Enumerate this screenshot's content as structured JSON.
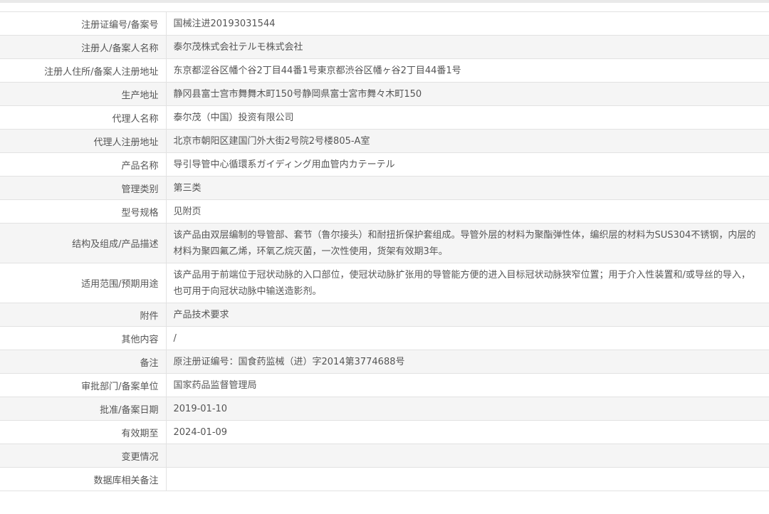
{
  "rows": [
    {
      "key": "注册证编号/备案号",
      "value": "国械注进20193031544"
    },
    {
      "key": "注册人/备案人名称",
      "value": "泰尔茂株式会社テルモ株式会社"
    },
    {
      "key": "注册人住所/备案人注册地址",
      "value": "东京都涩谷区幡个谷2丁目44番1号東京都渋谷区幡ヶ谷2丁目44番1号"
    },
    {
      "key": "生产地址",
      "value": "静冈县富士宫市舞舞木町150号静岡県富士宮市舞々木町150"
    },
    {
      "key": "代理人名称",
      "value": "泰尔茂（中国）投资有限公司"
    },
    {
      "key": "代理人注册地址",
      "value": "北京市朝阳区建国门外大街2号院2号楼805-A室"
    },
    {
      "key": "产品名称",
      "value": "导引导管中心循環系ガイディング用血管内カテーテル"
    },
    {
      "key": "管理类别",
      "value": "第三类"
    },
    {
      "key": "型号规格",
      "value": "见附页"
    },
    {
      "key": "结构及组成/产品描述",
      "value": "该产品由双层编制的导管部、套节（鲁尔接头）和耐扭折保护套组成。导管外层的材料为聚酯弹性体，编织层的材料为SUS304不锈钢，内层的材料为聚四氟乙烯，环氧乙烷灭菌，一次性使用，货架有效期3年。"
    },
    {
      "key": "适用范围/预期用途",
      "value": "该产品用于前端位于冠状动脉的入口部位，使冠状动脉扩张用的导管能方便的进入目标冠状动脉狭窄位置；用于介入性装置和/或导丝的导入，也可用于向冠状动脉中输送造影剂。"
    },
    {
      "key": "附件",
      "value": "产品技术要求"
    },
    {
      "key": "其他内容",
      "value": "/"
    },
    {
      "key": "备注",
      "value": "原注册证编号：国食药监械（进）字2014第3774688号"
    },
    {
      "key": "审批部门/备案单位",
      "value": "国家药品监督管理局"
    },
    {
      "key": "批准/备案日期",
      "value": "2019-01-10"
    },
    {
      "key": "有效期至",
      "value": "2024-01-09"
    },
    {
      "key": "变更情况",
      "value": ""
    },
    {
      "key": "数据库相关备注",
      "value": ""
    }
  ]
}
